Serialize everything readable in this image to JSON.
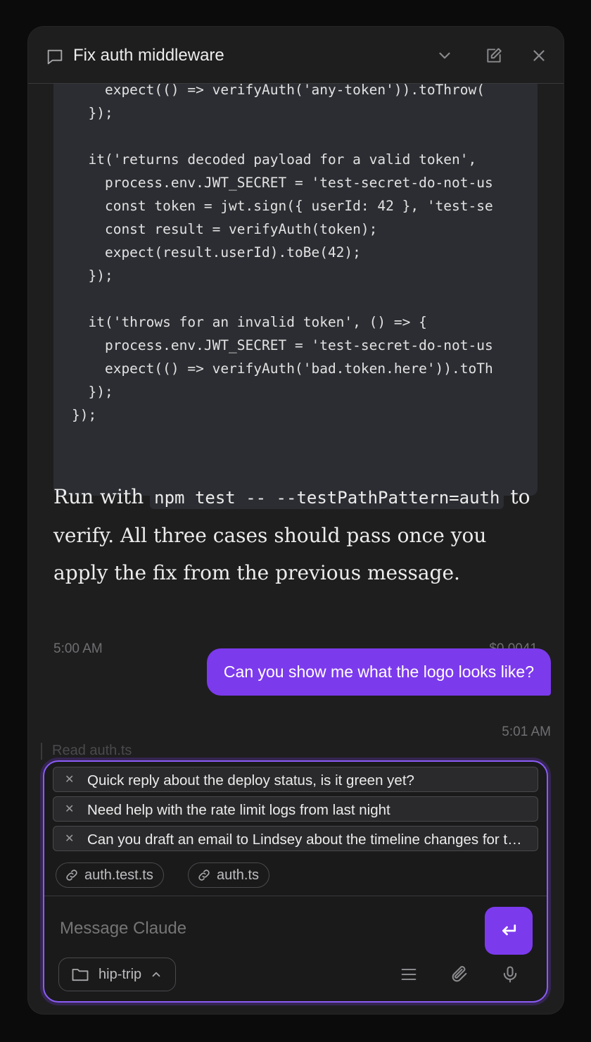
{
  "header": {
    "title": "Fix auth middleware",
    "icons": [
      "chat-bubble-icon",
      "chevron-down-icon",
      "edit-icon",
      "close-icon"
    ]
  },
  "code": {
    "lines": [
      "    expect(() => verifyAuth('any-token')).toThrow(",
      "  });",
      "",
      "  it('returns decoded payload for a valid token', ",
      "    process.env.JWT_SECRET = 'test-secret-do-not-us",
      "    const token = jwt.sign({ userId: 42 }, 'test-se",
      "    const result = verifyAuth(token);",
      "    expect(result.userId).toBe(42);",
      "  });",
      "",
      "  it('throws for an invalid token', () => {",
      "    process.env.JWT_SECRET = 'test-secret-do-not-us",
      "    expect(() => verifyAuth('bad.token.here')).toTh",
      "  });",
      "});"
    ]
  },
  "assistant": {
    "text_before": "Run with ",
    "code1": "npm test -- --testPathPattern=auth",
    "text_after": " to verify. All three cases should pass once you apply the fix from the previous message.",
    "time": "5:00 AM",
    "cost": "$0.0041"
  },
  "user_message": {
    "text": "Can you show me what the logo looks like?",
    "time": "5:01 AM"
  },
  "peek_text": "Read  auth.ts",
  "queue": [
    "Quick reply about the deploy status, is it green yet?",
    "Need help with the rate limit logs from last night",
    "Can you draft an email to Lindsey about the timeline changes for the launch"
  ],
  "attachments": [
    "auth.test.ts",
    "auth.ts"
  ],
  "composer": {
    "placeholder": "Message Claude",
    "project": "hip-trip"
  },
  "colors": {
    "accent": "#7c3aed",
    "panel": "#1e1e1f",
    "code_bg": "#2c2d32"
  }
}
